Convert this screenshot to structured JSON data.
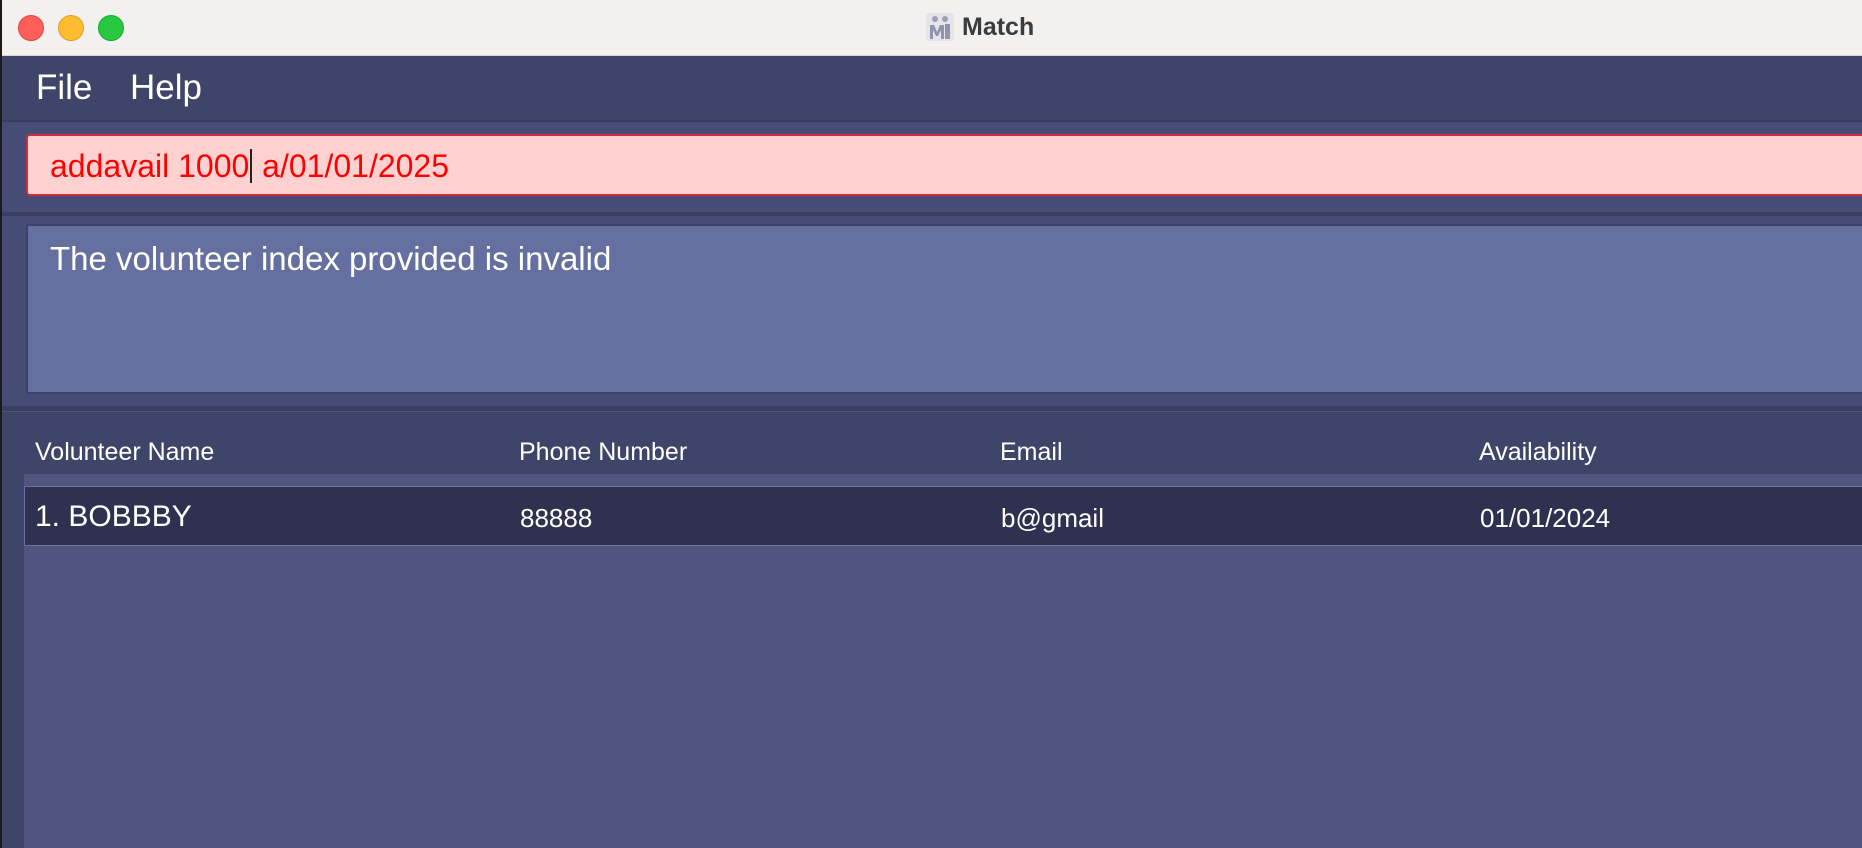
{
  "window": {
    "title": "Match",
    "app_icon": "people-icon"
  },
  "menu": {
    "file_label": "File",
    "help_label": "Help"
  },
  "command": {
    "text_before_caret": "addavail 1000",
    "text_after_caret": " a/01/01/2025",
    "state": "error"
  },
  "result": {
    "message": "The volunteer index provided is invalid"
  },
  "table": {
    "headers": [
      "Volunteer Name",
      "Phone Number",
      "Email",
      "Availability"
    ],
    "rows": [
      {
        "name": "1. BOBBBY",
        "phone": "88888",
        "email": "b@gmail",
        "availability": "01/01/2024"
      }
    ]
  },
  "colors": {
    "command_error_bg": "#ffd1d1",
    "command_error_text": "#ff0000",
    "result_bg": "#6670a0",
    "panel_bg": "#4f557f",
    "selected_row_bg": "#2e3150"
  }
}
